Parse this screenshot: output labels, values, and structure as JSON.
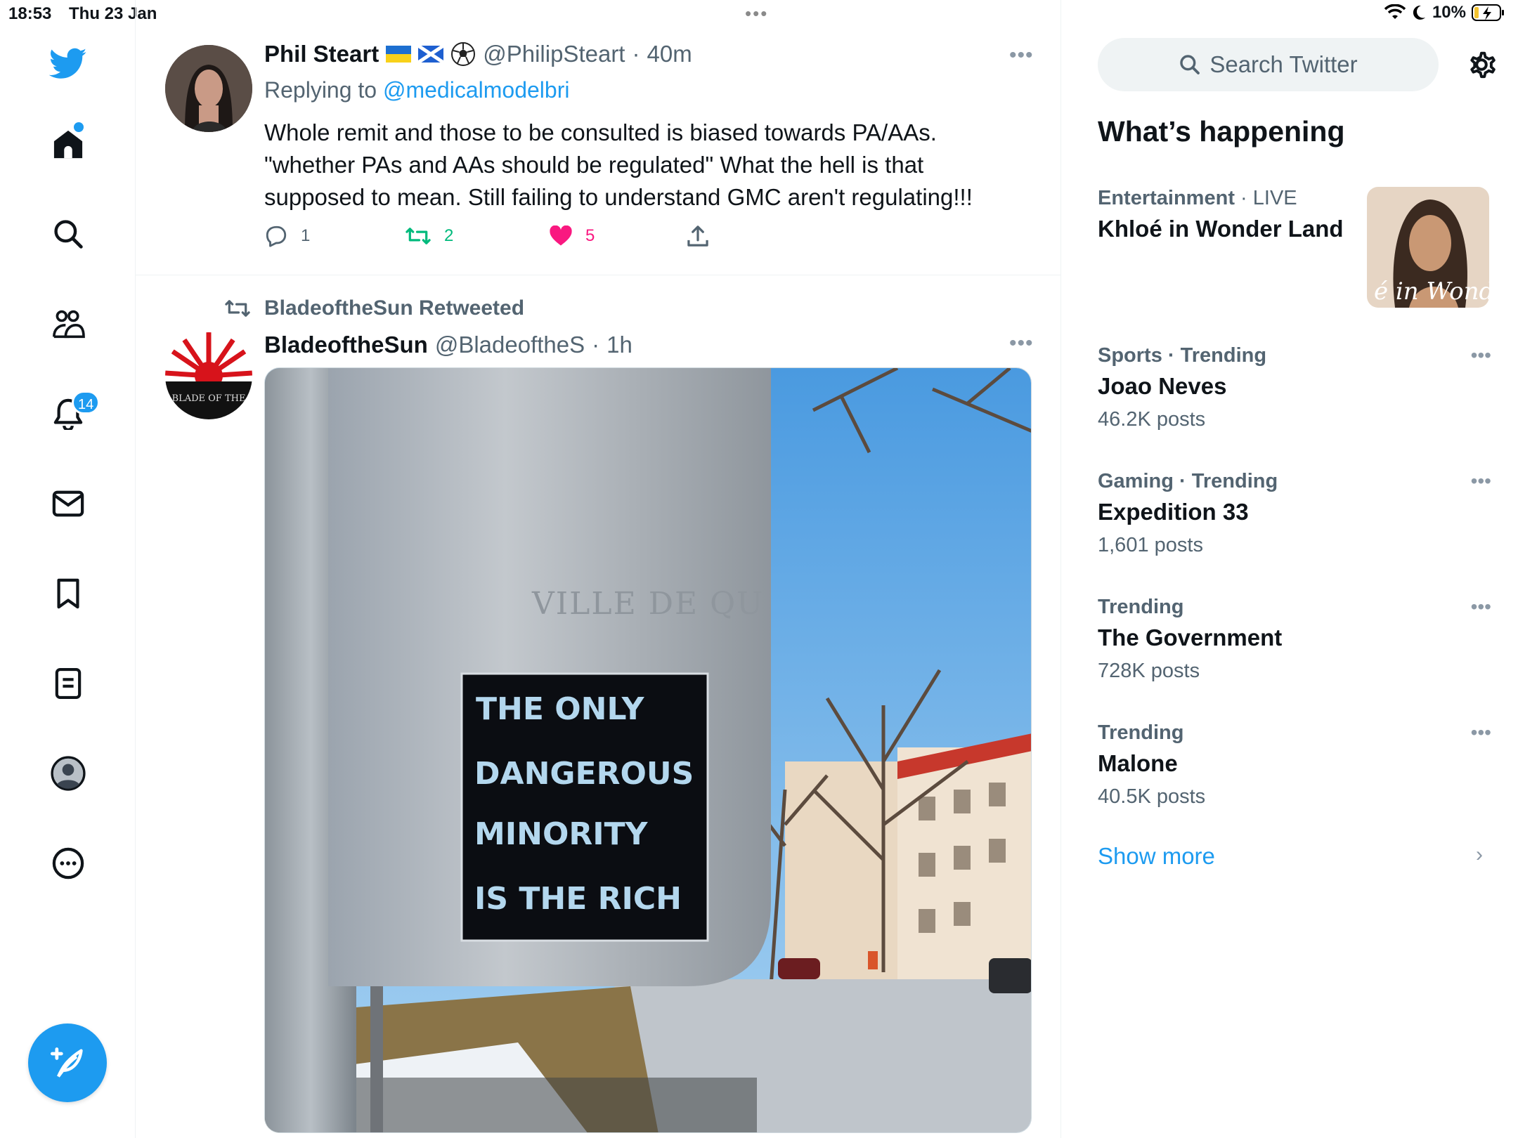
{
  "status_bar": {
    "time": "18:53",
    "date": "Thu 23 Jan",
    "battery": "10%"
  },
  "nav": {
    "notifications_badge": "14",
    "items": [
      "twitter-logo",
      "home-icon",
      "search-icon",
      "communities-icon",
      "notifications-icon",
      "messages-icon",
      "bookmarks-icon",
      "lists-icon",
      "profile-icon",
      "more-icon"
    ]
  },
  "tweet1": {
    "name": "Phil Steart",
    "handle": "@PhilipSteart",
    "sep": "·",
    "time": "40m",
    "replying_prefix": "Replying to",
    "replying_to": "@medicalmodelbri",
    "text": "Whole remit and those to be consulted is biased towards PA/AAs. \"whether PAs and AAs should be regulated\" What the hell is that supposed to mean. Still failing to understand GMC aren't regulating!!!",
    "replies": "1",
    "retweets": "2",
    "likes": "5"
  },
  "tweet2": {
    "retweeted_by": "BladeoftheSun Retweeted",
    "name": "BladeoftheSun",
    "handle": "@BladeoftheS",
    "sep": "·",
    "time": "1h",
    "image_text": [
      "THE ONLY",
      "DANGEROUS",
      "MINORITY",
      "IS THE RICH"
    ],
    "image_sign_text": "VILLE DE QU",
    "avatar_text": "BLADE OF THE"
  },
  "right": {
    "search_placeholder": "Search Twitter",
    "whats_happening": "What’s happening",
    "trends": [
      {
        "category": "Entertainment",
        "sep": " · ",
        "context": "LIVE",
        "title": "Khloé in Wonder Land",
        "posts": "",
        "image_caption": "é in Wonder l"
      },
      {
        "category": "Sports",
        "sep": " · ",
        "context": "Trending",
        "title": "Joao Neves",
        "posts": "46.2K posts"
      },
      {
        "category": "Gaming",
        "sep": " · ",
        "context": "Trending",
        "title": "Expedition 33",
        "posts": "1,601 posts"
      },
      {
        "category": "Trending",
        "sep": "",
        "context": "",
        "title": "The Government",
        "posts": "728K posts"
      },
      {
        "category": "Trending",
        "sep": "",
        "context": "",
        "title": "Malone",
        "posts": "40.5K posts"
      }
    ],
    "show_more": "Show more"
  },
  "colors": {
    "accent": "#1d9bf0",
    "like": "#f91880",
    "retweet": "#00ba7c",
    "secondary_text": "#536471"
  }
}
